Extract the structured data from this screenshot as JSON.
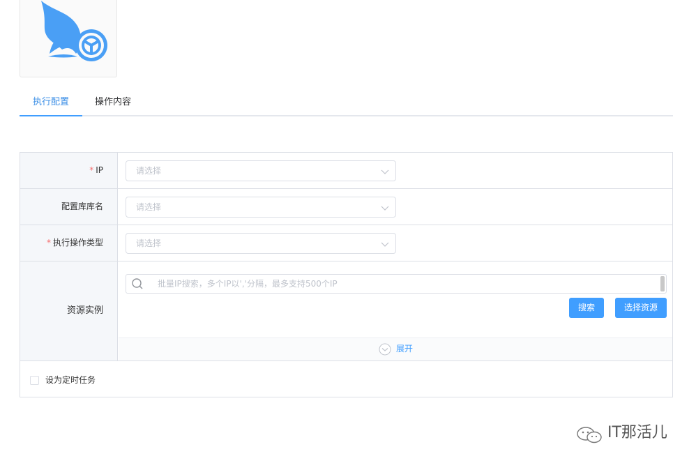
{
  "header": {
    "title_fragment": "-"
  },
  "tabs": [
    {
      "label": "执行配置",
      "active": true
    },
    {
      "label": "操作内容",
      "active": false
    }
  ],
  "form": {
    "ip": {
      "label": "IP",
      "required": true,
      "placeholder": "请选择"
    },
    "db_name": {
      "label": "配置库库名",
      "required": false,
      "placeholder": "请选择"
    },
    "op_type": {
      "label": "执行操作类型",
      "required": true,
      "placeholder": "请选择"
    },
    "resource": {
      "label": "资源实例",
      "search_placeholder": "批量IP搜索，多个IP以','分隔，最多支持500个IP",
      "search_button": "搜索",
      "select_button": "选择资源",
      "expand_label": "展开"
    },
    "scheduled": {
      "label": "设为定时任务",
      "checked": false
    }
  },
  "required_mark": "*",
  "watermark": {
    "text": "IT那活儿"
  },
  "colors": {
    "accent": "#409eff",
    "required": "#f56c6c",
    "logo": "#4a9ff5"
  }
}
